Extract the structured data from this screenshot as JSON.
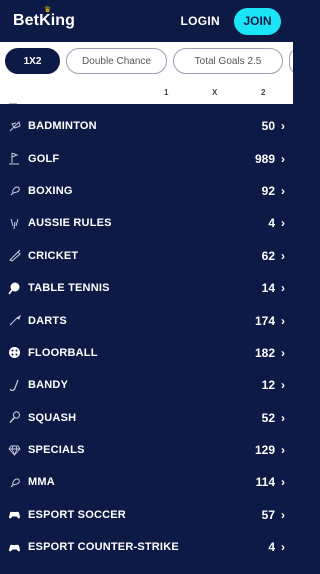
{
  "header": {
    "brand": "BetKing",
    "login_label": "LOGIN",
    "join_label": "JOIN"
  },
  "market_tabs": [
    {
      "label": "1X2",
      "active": true
    },
    {
      "label": "Double Chance",
      "active": false
    },
    {
      "label": "Total Goals 2.5",
      "active": false
    },
    {
      "label": "",
      "active": false
    }
  ],
  "columns": [
    "1",
    "X",
    "2"
  ],
  "sports": [
    {
      "label": "BADMINTON",
      "count": "50",
      "icon": "shuttlecock-icon"
    },
    {
      "label": "GOLF",
      "count": "989",
      "icon": "golf-icon"
    },
    {
      "label": "BOXING",
      "count": "92",
      "icon": "boxing-glove-icon"
    },
    {
      "label": "AUSSIE RULES",
      "count": "4",
      "icon": "aussie-rules-icon"
    },
    {
      "label": "CRICKET",
      "count": "62",
      "icon": "cricket-bat-icon"
    },
    {
      "label": "TABLE TENNIS",
      "count": "14",
      "icon": "table-tennis-icon"
    },
    {
      "label": "DARTS",
      "count": "174",
      "icon": "dart-icon"
    },
    {
      "label": "FLOORBALL",
      "count": "182",
      "icon": "floorball-icon"
    },
    {
      "label": "BANDY",
      "count": "12",
      "icon": "bandy-stick-icon"
    },
    {
      "label": "SQUASH",
      "count": "52",
      "icon": "squash-racket-icon"
    },
    {
      "label": "SPECIALS",
      "count": "129",
      "icon": "diamond-icon"
    },
    {
      "label": "MMA",
      "count": "114",
      "icon": "mma-glove-icon"
    },
    {
      "label": "ESPORT SOCCER",
      "count": "57",
      "icon": "gamepad-icon"
    },
    {
      "label": "ESPORT COUNTER-STRIKE",
      "count": "4",
      "icon": "gamepad-icon"
    }
  ],
  "colors": {
    "background": "#0c1a45",
    "accent": "#1be6f7",
    "crown": "#f5c400"
  }
}
